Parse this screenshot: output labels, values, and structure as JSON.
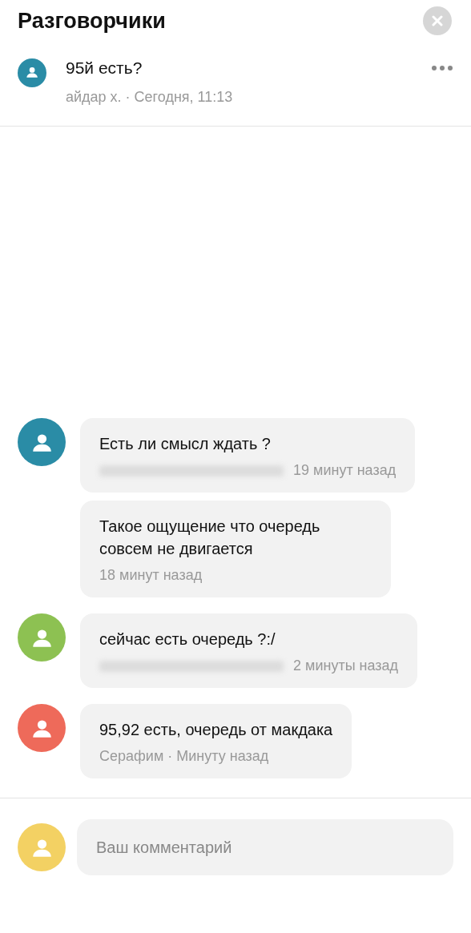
{
  "header": {
    "title": "Разговорчики"
  },
  "post": {
    "title": "95й есть?",
    "meta": "айдар х. · Сегодня, 11:13",
    "color": "#2a8ca6"
  },
  "messages": [
    {
      "color": "#2a8ca6",
      "bubbles": [
        {
          "text": "Есть ли смысл ждать ?",
          "blurred_author": true,
          "meta": "19 минут назад"
        },
        {
          "text": "Такое ощущение что очередь совсем не двигается",
          "blurred_author": false,
          "meta": "18 минут назад"
        }
      ]
    },
    {
      "color": "#8dc152",
      "bubbles": [
        {
          "text": "сейчас есть очередь ?:/",
          "blurred_author": true,
          "meta": "2 минуты назад"
        }
      ]
    },
    {
      "color": "#ee6a5a",
      "bubbles": [
        {
          "text": "95,92 есть, очередь от макдака",
          "blurred_author": false,
          "meta": "Серафим · Минуту назад"
        }
      ]
    }
  ],
  "composer": {
    "placeholder": "Ваш комментарий",
    "color": "#f3d163"
  }
}
